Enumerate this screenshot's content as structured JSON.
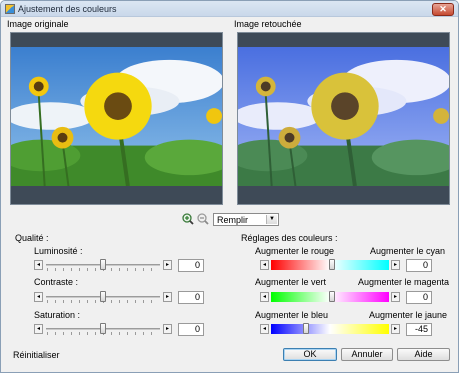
{
  "window": {
    "title": "Ajustement des couleurs",
    "close_glyph": "✕"
  },
  "images": {
    "original_caption": "Image originale",
    "retouched_caption": "Image retouchée"
  },
  "toolbar": {
    "zoom_in_icon": "zoom-in-icon",
    "zoom_out_icon": "zoom-out-icon",
    "fill_mode": "Remplir"
  },
  "quality": {
    "group_label": "Qualité :",
    "brightness": {
      "label": "Luminosité :",
      "value": "0"
    },
    "contrast": {
      "label": "Contraste :",
      "value": "0"
    },
    "saturation": {
      "label": "Saturation :",
      "value": "0"
    }
  },
  "colors": {
    "group_label": "Réglages des couleurs :",
    "red_cyan": {
      "left_label": "Augmenter le rouge",
      "right_label": "Augmenter le cyan",
      "value": "0"
    },
    "green_magenta": {
      "left_label": "Augmenter le vert",
      "right_label": "Augmenter le magenta",
      "value": "0"
    },
    "blue_yellow": {
      "left_label": "Augmenter le bleu",
      "right_label": "Augmenter le jaune",
      "value": "-45"
    }
  },
  "footer": {
    "reset_label": "Réinitialiser",
    "ok_label": "OK",
    "cancel_label": "Annuler",
    "help_label": "Aide"
  },
  "arrows": {
    "left": "◂",
    "right": "▸"
  },
  "palette": {
    "accent": "#3c7fb1",
    "red": "#ff0000",
    "cyan": "#00ffff",
    "green": "#00ff00",
    "magenta": "#ff00ff",
    "blue": "#0000ff",
    "yellow": "#ffff00"
  }
}
